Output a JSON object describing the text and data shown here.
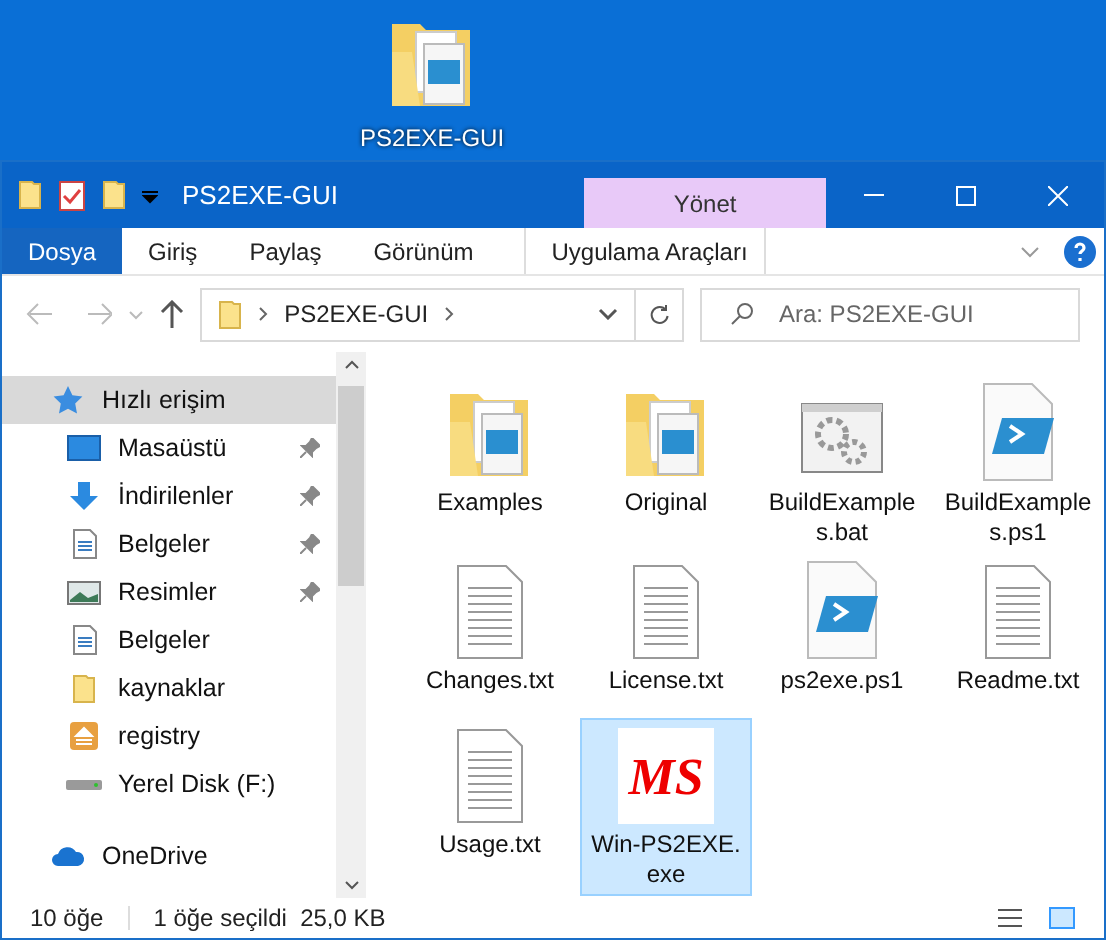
{
  "desktop_icon": {
    "label": "PS2EXE-GUI"
  },
  "window": {
    "title": "PS2EXE-GUI"
  },
  "context_tab": {
    "label": "Yönet"
  },
  "ribbon_tabs": [
    {
      "label": "Dosya",
      "selected": true
    },
    {
      "label": "Giriş",
      "selected": false
    },
    {
      "label": "Paylaş",
      "selected": false
    },
    {
      "label": "Görünüm",
      "selected": false
    },
    {
      "label": "Uygulama Araçları",
      "selected": false
    }
  ],
  "address": {
    "path": "PS2EXE-GUI"
  },
  "search": {
    "placeholder": "Ara: PS2EXE-GUI"
  },
  "sidebar": {
    "items": [
      {
        "label": "Hızlı erişim",
        "kind": "star",
        "selected": true,
        "pinned": false,
        "children": [
          {
            "label": "Masaüstü",
            "kind": "desktop",
            "selected": false,
            "pinned": true
          },
          {
            "label": "İndirilenler",
            "kind": "download",
            "selected": false,
            "pinned": true
          },
          {
            "label": "Belgeler",
            "kind": "document",
            "selected": false,
            "pinned": true
          },
          {
            "label": "Resimler",
            "kind": "picture",
            "selected": false,
            "pinned": true
          },
          {
            "label": "Belgeler",
            "kind": "document",
            "selected": false,
            "pinned": false
          },
          {
            "label": "kaynaklar",
            "kind": "folder",
            "selected": false,
            "pinned": false
          },
          {
            "label": "registry",
            "kind": "registry",
            "selected": false,
            "pinned": false
          },
          {
            "label": "Yerel Disk (F:)",
            "kind": "drive",
            "selected": false,
            "pinned": false
          }
        ]
      },
      {
        "label": "OneDrive",
        "kind": "cloud",
        "selected": false,
        "pinned": false
      }
    ]
  },
  "files": [
    {
      "name": "Examples",
      "kind": "folder",
      "selected": false
    },
    {
      "name": "Original",
      "kind": "folder",
      "selected": false
    },
    {
      "name": "BuildExamples.bat",
      "kind": "bat",
      "selected": false
    },
    {
      "name": "BuildExamples.ps1",
      "kind": "ps1",
      "selected": false
    },
    {
      "name": "Changes.txt",
      "kind": "txt",
      "selected": false
    },
    {
      "name": "License.txt",
      "kind": "txt",
      "selected": false
    },
    {
      "name": "ps2exe.ps1",
      "kind": "ps1",
      "selected": false
    },
    {
      "name": "Readme.txt",
      "kind": "txt",
      "selected": false
    },
    {
      "name": "Usage.txt",
      "kind": "txt",
      "selected": false
    },
    {
      "name": "Win-PS2EXE.exe",
      "kind": "exe",
      "selected": true,
      "badge": "MS"
    }
  ],
  "status_bar": {
    "count": "10 öğe",
    "selection": "1 öğe seçildi  25,0 KB"
  }
}
